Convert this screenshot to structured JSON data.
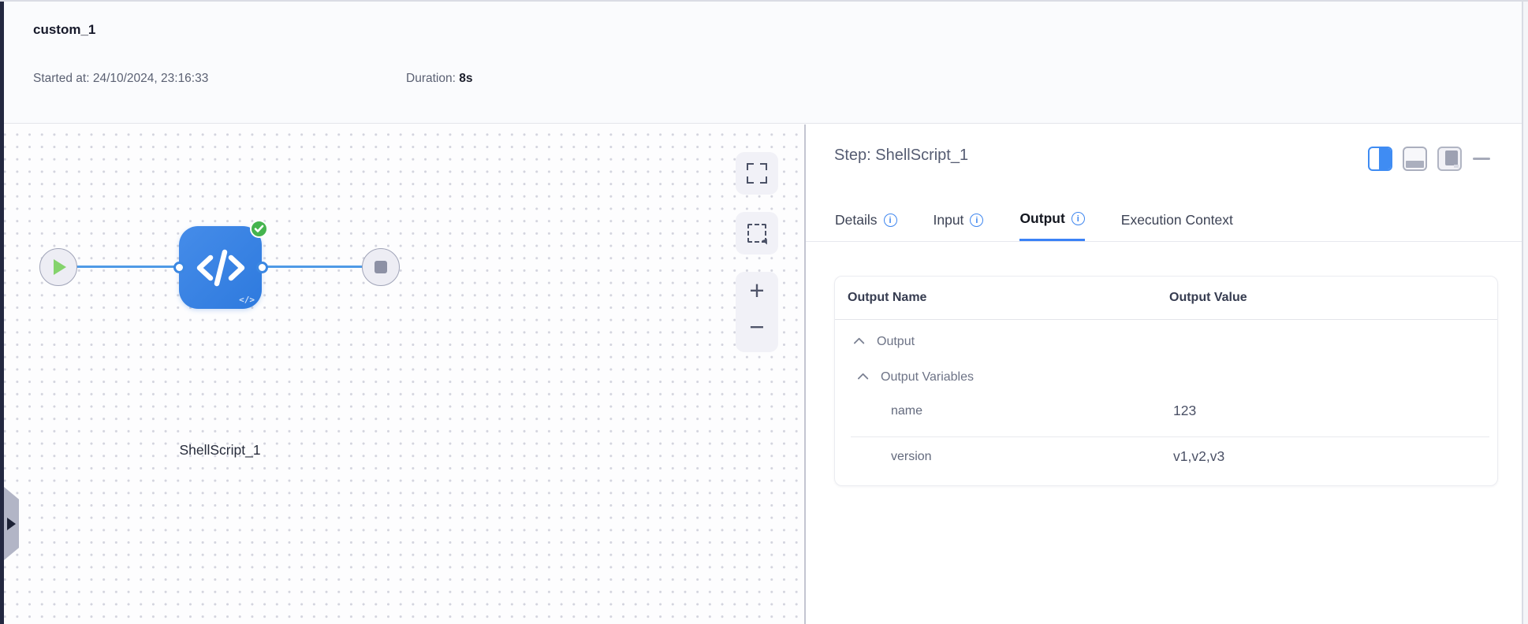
{
  "header": {
    "title": "custom_1",
    "started_label": "Started at:",
    "started_value": "24/10/2024, 23:16:33",
    "duration_label": "Duration:",
    "duration_value": "8s"
  },
  "canvas": {
    "node": {
      "label": "ShellScript_1",
      "type": "shell-script",
      "status": "success",
      "mini_icon": "</>"
    },
    "controls": {
      "zoom_in": "+",
      "zoom_out": "−"
    }
  },
  "panel": {
    "title": "Step: ShellScript_1",
    "info_glyph": "i",
    "tabs": [
      {
        "label": "Details",
        "has_info": true,
        "active": false
      },
      {
        "label": "Input",
        "has_info": true,
        "active": false
      },
      {
        "label": "Output",
        "has_info": true,
        "active": true
      },
      {
        "label": "Execution Context",
        "has_info": false,
        "active": false
      }
    ],
    "table": {
      "columns": [
        "Output Name",
        "Output Value"
      ],
      "groups": [
        {
          "label": "Output",
          "expanded": true,
          "level": 0
        },
        {
          "label": "Output Variables",
          "expanded": true,
          "level": 1
        }
      ],
      "rows": [
        {
          "name": "name",
          "value": "123"
        },
        {
          "name": "version",
          "value": "v1,v2,v3"
        }
      ]
    }
  },
  "colors": {
    "accent_blue": "#3b82f6",
    "node_blue": "#3a84e6",
    "edge_blue": "#4f9ae6",
    "success_green": "#45b44e"
  }
}
